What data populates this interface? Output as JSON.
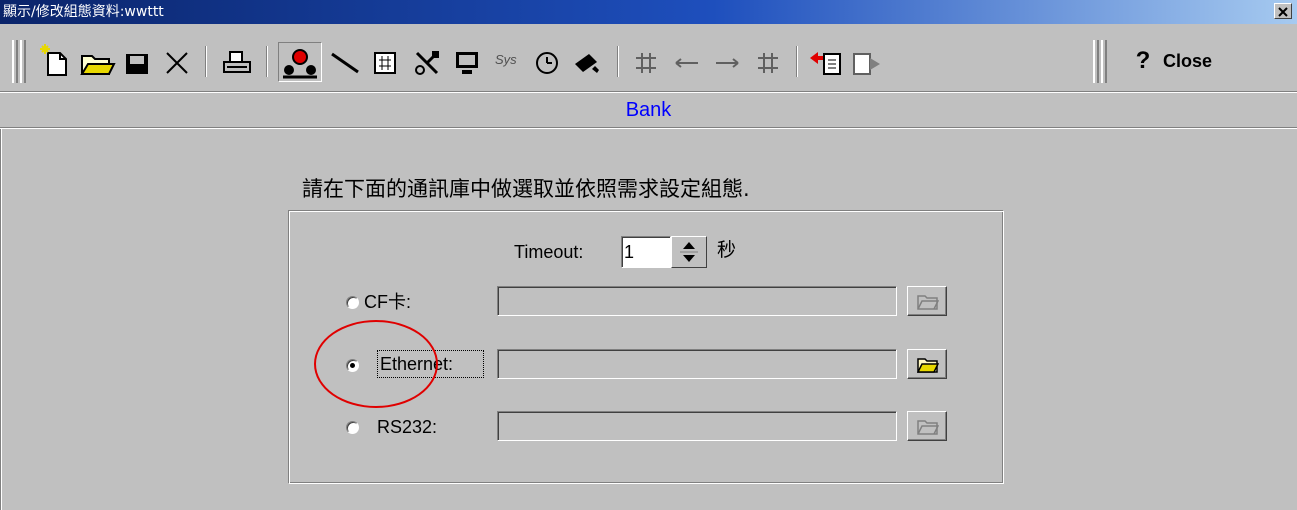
{
  "window": {
    "title": "顯示/修改組態資料:wwttt",
    "close_glyph": "✕"
  },
  "toolbar": {
    "buttons": [
      {
        "name": "new-icon"
      },
      {
        "name": "open-folder-icon"
      },
      {
        "name": "save-icon"
      },
      {
        "name": "delete-icon"
      },
      {
        "name": "print-icon"
      },
      {
        "name": "communication-icon"
      },
      {
        "name": "line-icon"
      },
      {
        "name": "table-icon"
      },
      {
        "name": "tools-icon"
      },
      {
        "name": "monitor-icon"
      },
      {
        "name": "system-icon",
        "label": "Sys"
      },
      {
        "name": "clock-icon"
      },
      {
        "name": "search-icon"
      },
      {
        "name": "move-first-icon"
      },
      {
        "name": "move-left-icon"
      },
      {
        "name": "move-right-icon"
      },
      {
        "name": "move-last-icon"
      },
      {
        "name": "import-icon"
      },
      {
        "name": "export-icon"
      }
    ],
    "help_label": "?",
    "close_label": "Close"
  },
  "section": {
    "title": "Bank"
  },
  "form": {
    "instruction": "請在下面的通訊庫中做選取並依照需求設定組態.",
    "timeout_label": "Timeout:",
    "timeout_value": "1",
    "timeout_unit": "秒",
    "options": [
      {
        "label": "CF卡:",
        "value": "",
        "selected": false,
        "enabled": false
      },
      {
        "label": "Ethernet:",
        "value": "",
        "selected": true,
        "enabled": true
      },
      {
        "label": "RS232:",
        "value": "",
        "selected": false,
        "enabled": false
      }
    ]
  },
  "annotation": {
    "color": "#e00000"
  },
  "colors": {
    "face": "#c0c0c0",
    "title_bar": "#0a246a",
    "section_title": "#0000ff",
    "folder_active": "#e8d800"
  }
}
